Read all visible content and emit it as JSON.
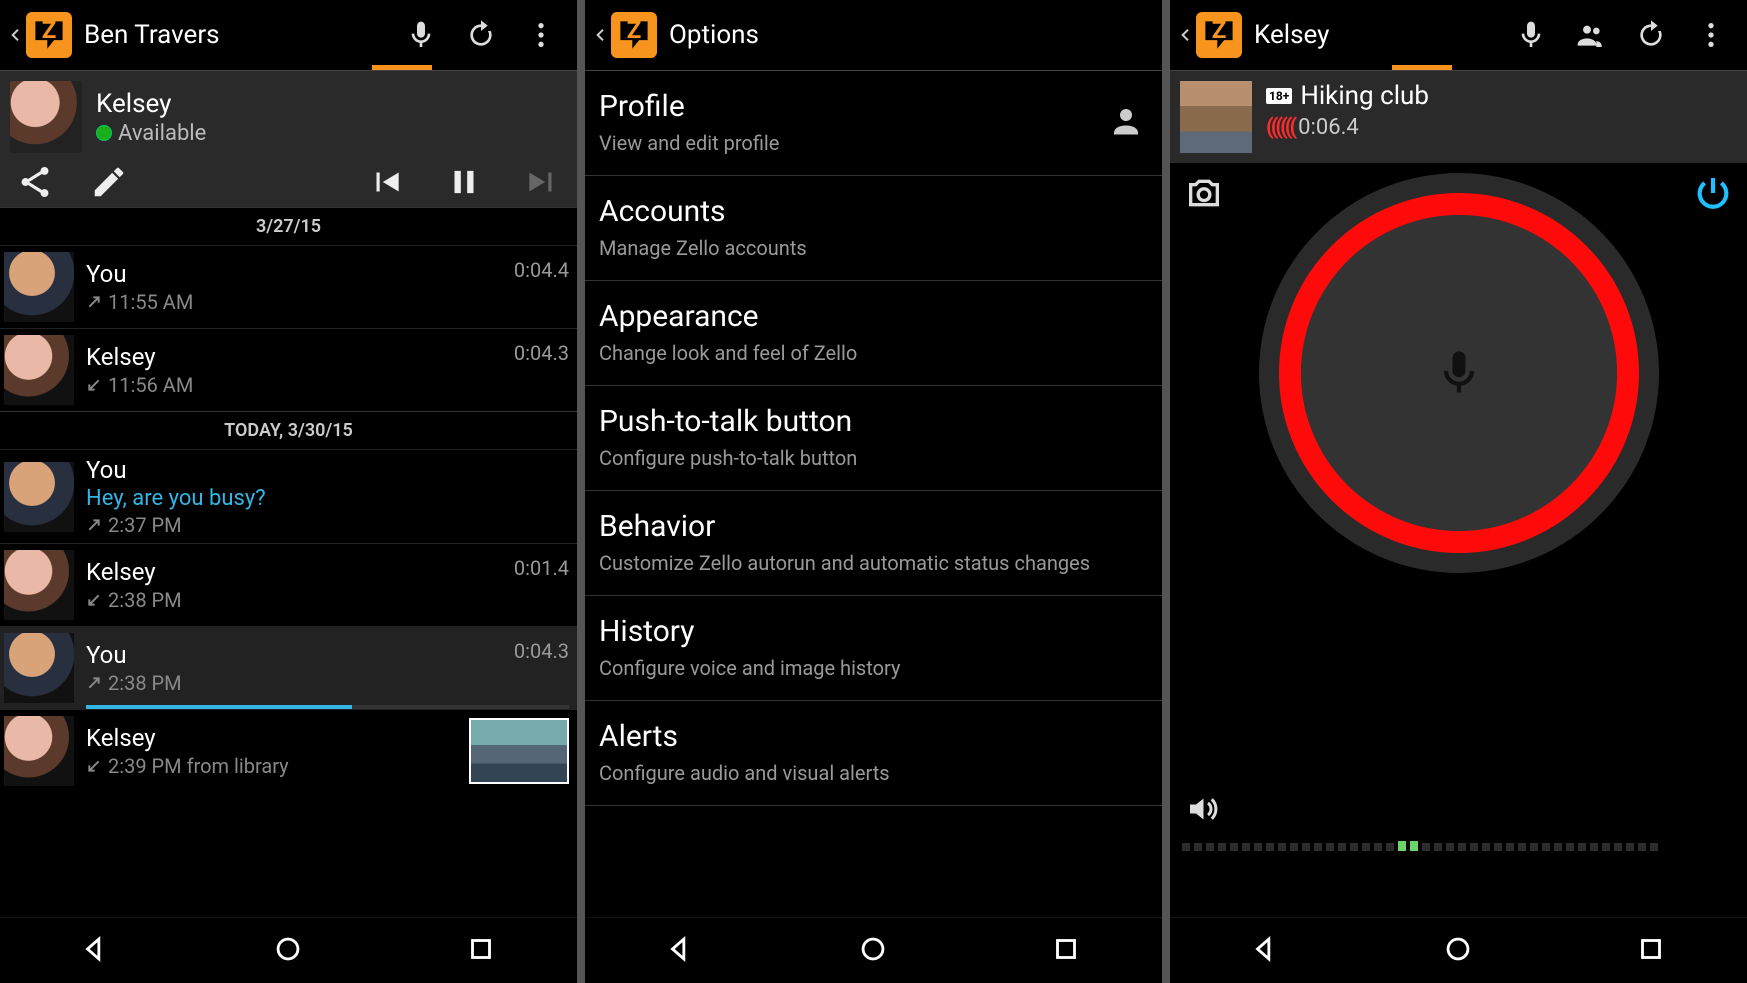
{
  "screen1": {
    "title": "Ben Travers",
    "contact": {
      "name": "Kelsey",
      "status": "Available"
    },
    "dates": {
      "d1": "3/27/15",
      "d2": "TODAY, 3/30/15"
    },
    "messages": [
      {
        "name": "You",
        "time": "11:55 AM",
        "dur": "0:04.4"
      },
      {
        "name": "Kelsey",
        "time": "11:56 AM",
        "dur": "0:04.3"
      },
      {
        "name": "You",
        "text": "Hey, are you busy?",
        "time": "2:37 PM",
        "dur": ""
      },
      {
        "name": "Kelsey",
        "time": "2:38 PM",
        "dur": "0:01.4"
      },
      {
        "name": "You",
        "time": "2:38 PM",
        "dur": "0:04.3"
      },
      {
        "name": "Kelsey",
        "time": "2:39 PM from library",
        "dur": ""
      }
    ]
  },
  "screen2": {
    "title": "Options",
    "items": [
      {
        "title": "Profile",
        "sub": "View and edit profile"
      },
      {
        "title": "Accounts",
        "sub": "Manage Zello accounts"
      },
      {
        "title": "Appearance",
        "sub": "Change look and feel of Zello"
      },
      {
        "title": "Push-to-talk button",
        "sub": "Configure push-to-talk button"
      },
      {
        "title": "Behavior",
        "sub": "Customize Zello autorun and automatic status changes"
      },
      {
        "title": "History",
        "sub": "Configure voice and image history"
      },
      {
        "title": "Alerts",
        "sub": "Configure audio and visual alerts"
      }
    ]
  },
  "screen3": {
    "title": "Kelsey",
    "channel": {
      "name": "Hiking club",
      "badge": "18+",
      "timer": "0:06.4"
    }
  }
}
